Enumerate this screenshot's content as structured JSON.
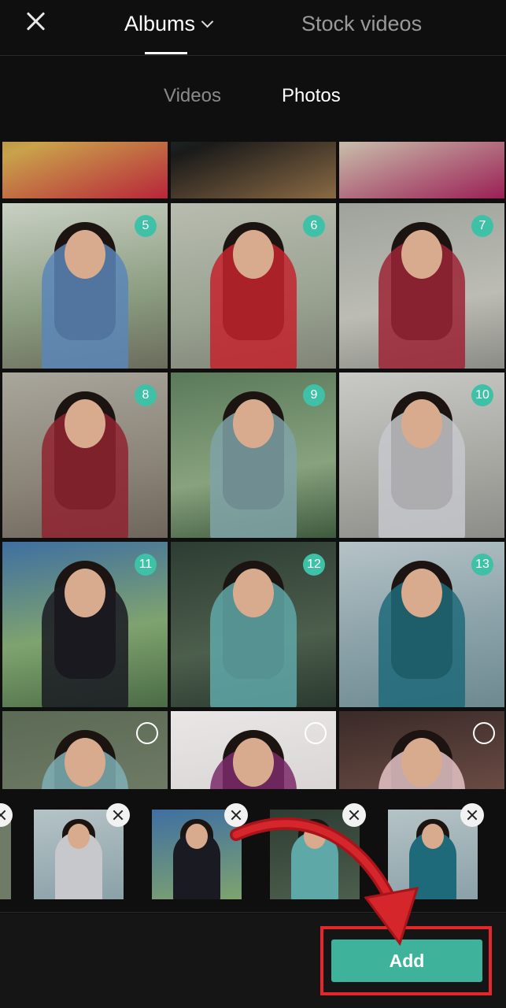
{
  "header": {
    "close_icon": "close-icon",
    "albums_label": "Albums",
    "stock_label": "Stock videos"
  },
  "subtabs": {
    "videos_label": "Videos",
    "photos_label": "Photos"
  },
  "grid": {
    "badges": [
      "5",
      "6",
      "7",
      "8",
      "9",
      "10",
      "11",
      "12",
      "13"
    ]
  },
  "tray": {
    "thumbnail_count": 5
  },
  "footer": {
    "add_label": "Add"
  },
  "colors": {
    "accent": "#3fb29c",
    "badge": "#3ec1a6",
    "annotation_red": "#e5262a"
  }
}
